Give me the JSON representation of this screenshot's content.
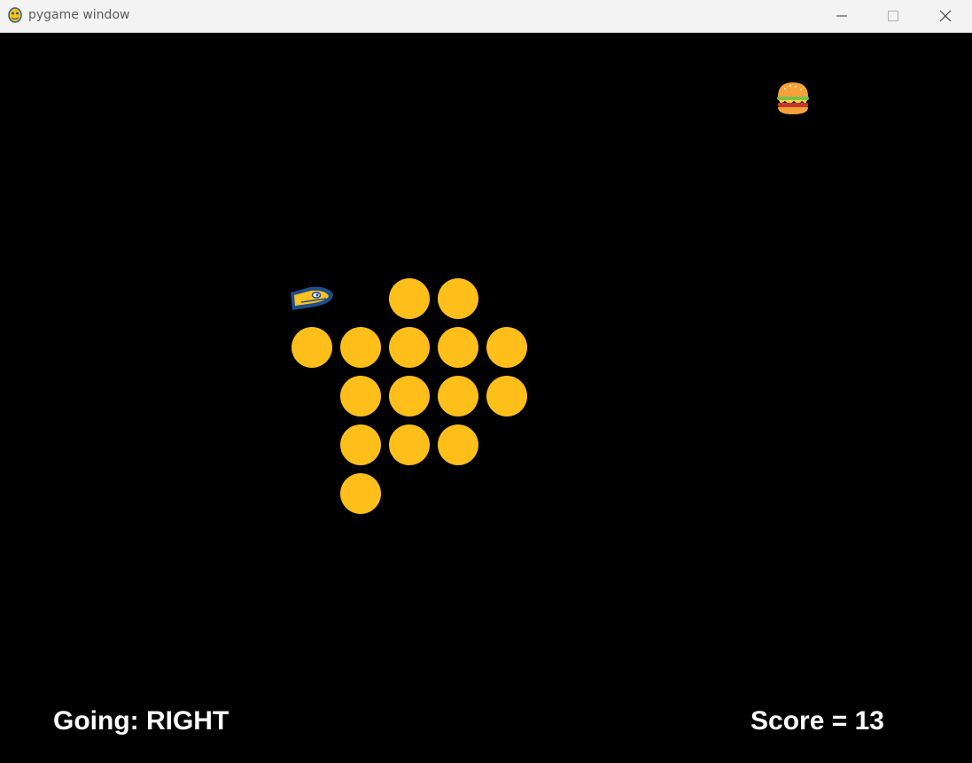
{
  "window": {
    "title": "pygame window",
    "app_icon": "pygame-snake-icon",
    "controls": [
      "minimize-icon",
      "maximize-icon",
      "close-icon"
    ]
  },
  "game": {
    "background_color": "#000000",
    "snake_color": "#ffbf1a",
    "head_icon": "snake-head-sprite",
    "food_icon": "burger-icon",
    "direction_text": "Going: RIGHT",
    "score_text": "Score = 13",
    "snake_segment_count": 17
  }
}
